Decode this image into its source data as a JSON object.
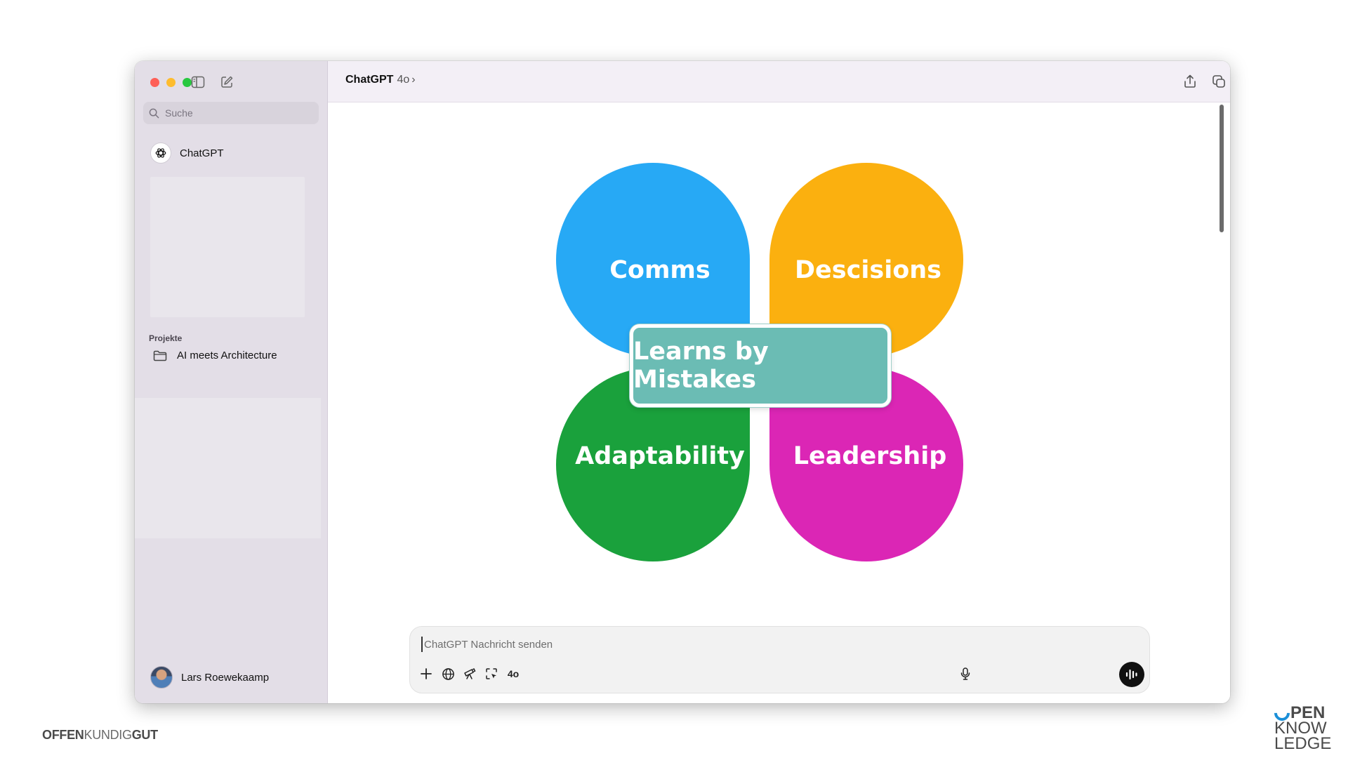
{
  "sidebar": {
    "search_placeholder": "Suche",
    "nav_chatgpt": "ChatGPT",
    "projects_label": "Projekte",
    "project_item": "AI meets Architecture",
    "user_name": "Lars Roewekaamp"
  },
  "header": {
    "model_name": "ChatGPT",
    "model_version": "4o",
    "chevron": "›"
  },
  "diagram": {
    "top_left": "Comms",
    "top_right": "Descisions",
    "bottom_left": "Adaptability",
    "bottom_right": "Leadership",
    "center": "Learns by Mistakes"
  },
  "colors": {
    "comms": "#27a9f5",
    "decisions": "#fbb00f",
    "adaptability": "#1aa13c",
    "leadership": "#db26b5",
    "center": "#6bbcb4"
  },
  "composer": {
    "placeholder": "ChatGPT Nachricht senden",
    "model_tool": "4o",
    "icons": [
      "plus-icon",
      "globe-icon",
      "telescope-icon",
      "cursor-select-icon",
      "microphone-icon",
      "voice-waveform-icon"
    ]
  },
  "branding": {
    "left_bold1": "OFFEN",
    "left_light": "KUNDIG",
    "left_bold2": "GUT",
    "right_line1": "PEN",
    "right_line2": "KNOW",
    "right_line3": "LEDGE"
  }
}
